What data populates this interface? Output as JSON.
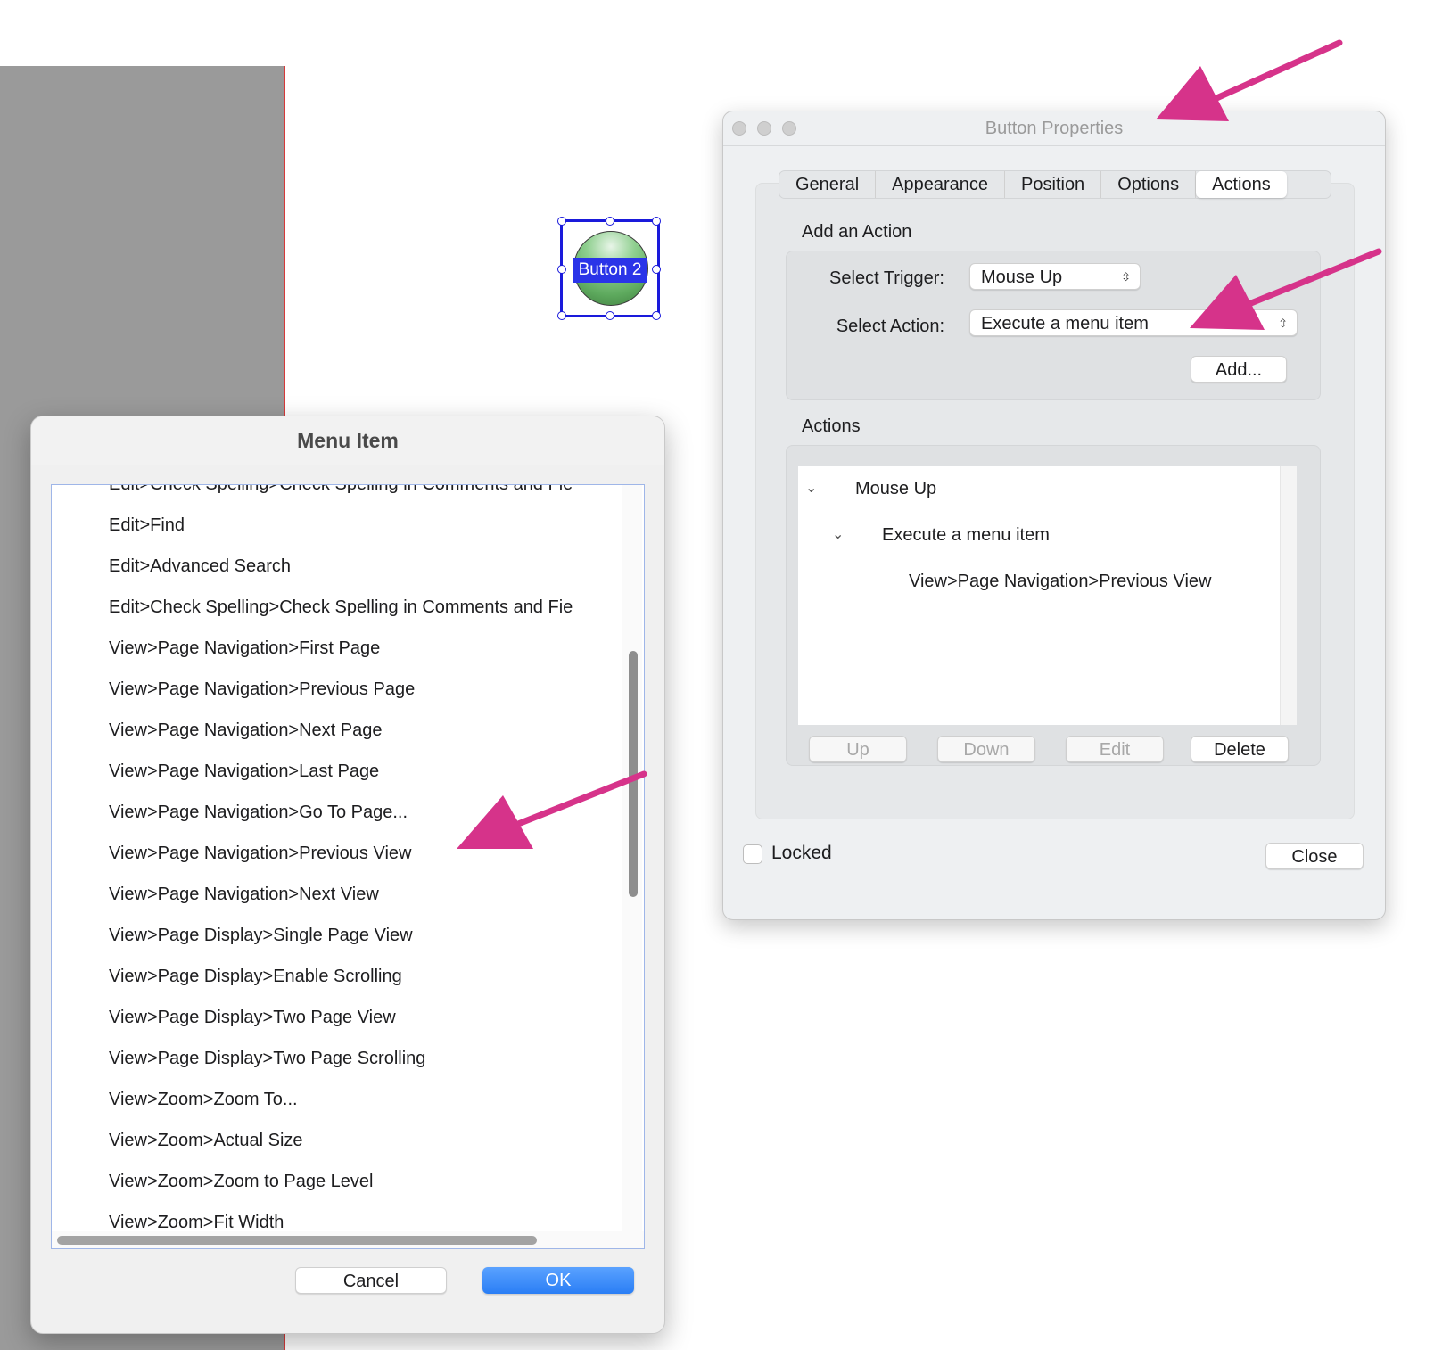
{
  "widget": {
    "label": "Button 2"
  },
  "button_properties": {
    "title": "Button Properties",
    "tabs": [
      "General",
      "Appearance",
      "Position",
      "Options",
      "Actions"
    ],
    "active_tab": "Actions",
    "add_action": {
      "section_label": "Add an Action",
      "trigger_label": "Select Trigger:",
      "trigger_value": "Mouse Up",
      "action_label": "Select Action:",
      "action_value": "Execute a menu item",
      "add_button": "Add..."
    },
    "actions": {
      "section_label": "Actions",
      "tree": [
        {
          "text": "Mouse Up",
          "level": 0
        },
        {
          "text": "Execute a menu item",
          "level": 1
        },
        {
          "text": "View>Page Navigation>Previous View",
          "level": 2
        }
      ],
      "buttons": {
        "up": "Up",
        "down": "Down",
        "edit": "Edit",
        "delete": "Delete"
      }
    },
    "locked_label": "Locked",
    "close_button": "Close"
  },
  "menu_item_dialog": {
    "title": "Menu Item",
    "items": [
      "Edit>Check Spelling>Check Spelling in Comments and Fie",
      "Edit>Find",
      "Edit>Advanced Search",
      "Edit>Check Spelling>Check Spelling in Comments and Fie",
      "View>Page Navigation>First Page",
      "View>Page Navigation>Previous Page",
      "View>Page Navigation>Next Page",
      "View>Page Navigation>Last Page",
      "View>Page Navigation>Go To Page...",
      "View>Page Navigation>Previous View",
      "View>Page Navigation>Next View",
      "View>Page Display>Single Page View",
      "View>Page Display>Enable Scrolling",
      "View>Page Display>Two Page View",
      "View>Page Display>Two Page Scrolling",
      "View>Zoom>Zoom To...",
      "View>Zoom>Actual Size",
      "View>Zoom>Zoom to Page Level",
      "View>Zoom>Fit Width"
    ],
    "cancel_button": "Cancel",
    "ok_button": "OK"
  },
  "colors": {
    "annotation_arrow": "#d6338a",
    "selection": "#1a1adb",
    "ok_blue": "#2a7ef5"
  }
}
